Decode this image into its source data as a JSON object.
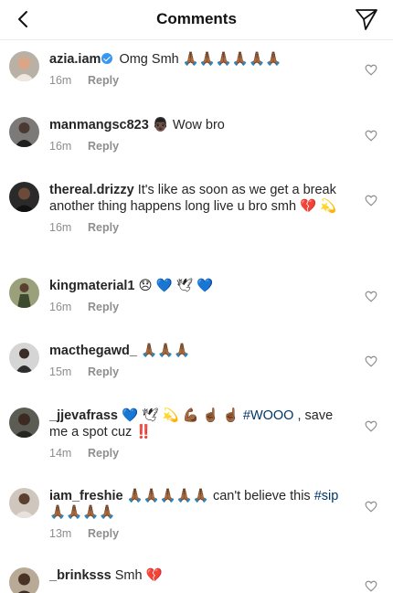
{
  "header": {
    "title": "Comments"
  },
  "comments": [
    {
      "username": "azia.iam",
      "verified": true,
      "text": "Omg Smh 🙏🏾🙏🏾🙏🏾🙏🏾🙏🏾🙏🏾",
      "time": "16m",
      "reply_label": "Reply"
    },
    {
      "username": "manmangsc823",
      "text": "👨🏿 Wow bro",
      "time": "16m",
      "reply_label": "Reply"
    },
    {
      "username": "thereal.drizzy",
      "text": "It's like as soon as we get a break another thing happens long live u bro smh 💔 💫",
      "time": "16m",
      "reply_label": "Reply"
    },
    {
      "username": "kingmaterial1",
      "text": "😞 💙 🕊 💙",
      "time": "16m",
      "reply_label": "Reply"
    },
    {
      "username": "macthegawd_",
      "text": "🙏🏾🙏🏾🙏🏾",
      "time": "15m",
      "reply_label": "Reply"
    },
    {
      "username": "_jjevafrass",
      "text": "💙 🕊 💫 💪🏾 ☝🏾 ☝🏾",
      "hashtag": "#WOOO",
      "text_after": " , save me a spot cuz ‼️",
      "time": "14m",
      "reply_label": "Reply"
    },
    {
      "username": "iam_freshie",
      "text": "🙏🏾🙏🏾🙏🏾🙏🏾🙏🏾 can't believe this",
      "hashtag": "#sip",
      "text_after": " 🙏🏾🙏🏾🙏🏾🙏🏾",
      "time": "13m",
      "reply_label": "Reply"
    },
    {
      "username": "_brinksss",
      "text": "Smh 💔",
      "time": "",
      "reply_label": ""
    }
  ],
  "colors": {
    "verified": "#3897f0",
    "hashtag": "#003569",
    "meta": "#8e8e8e"
  }
}
